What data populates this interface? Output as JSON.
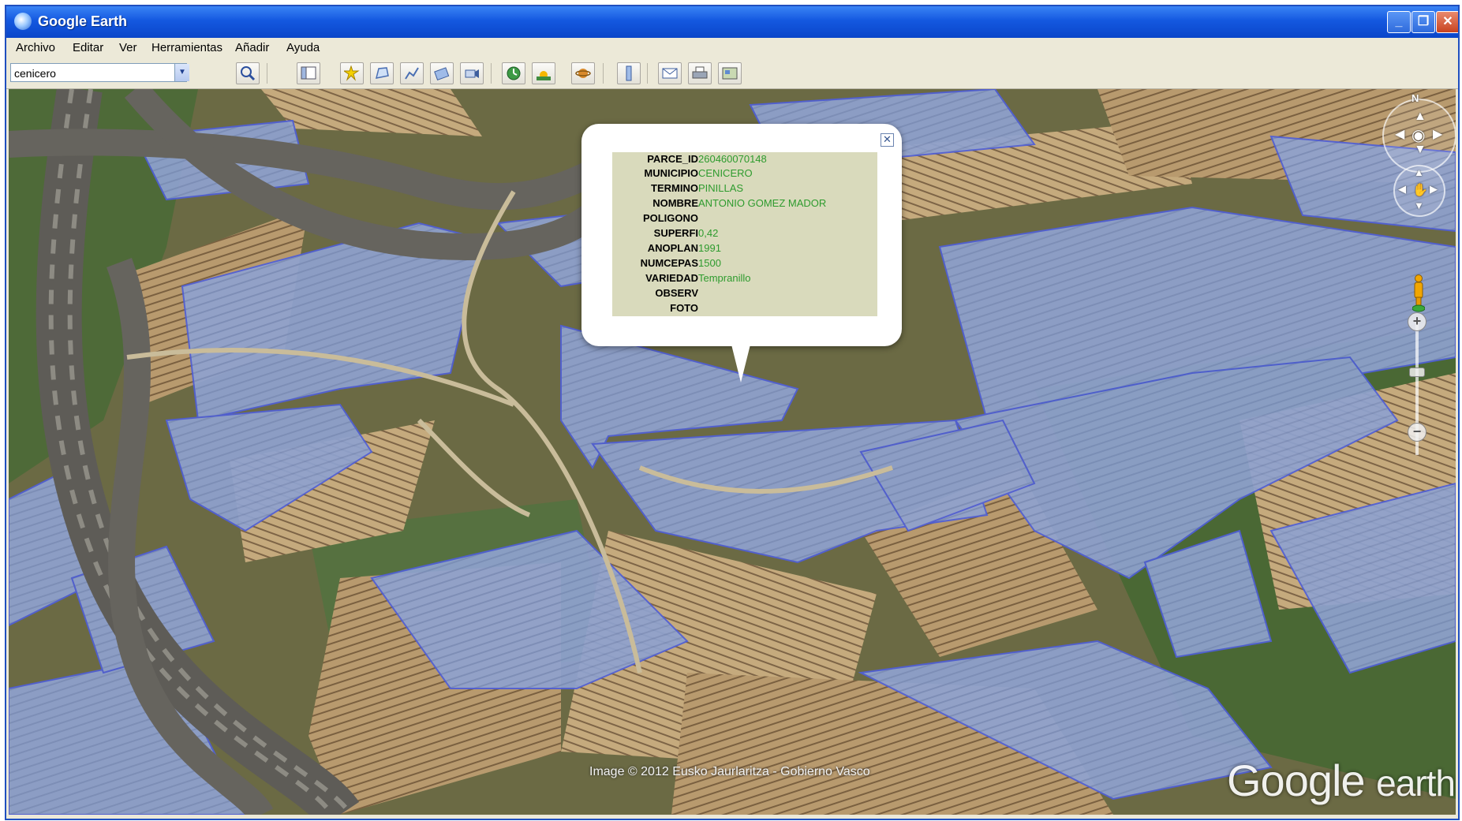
{
  "window": {
    "title": "Google Earth",
    "controls": {
      "minimize": "_",
      "restore": "❐",
      "close": "✕"
    }
  },
  "menu": {
    "items": [
      "Archivo",
      "Editar",
      "Ver",
      "Herramientas",
      "Añadir",
      "Ayuda"
    ]
  },
  "search": {
    "value": "cenicero",
    "dropdown_glyph": "▼"
  },
  "toolbar": {
    "icons": [
      "search-icon",
      "sidebar-toggle-icon",
      "add-placemark-icon",
      "add-polygon-icon",
      "add-path-icon",
      "add-overlay-icon",
      "record-tour-icon",
      "historical-imagery-icon",
      "sunlight-icon",
      "switch-to-sky-icon",
      "ruler-icon",
      "email-icon",
      "print-icon",
      "view-in-maps-icon"
    ]
  },
  "popup": {
    "close_glyph": "✕",
    "rows": [
      {
        "key": "PARCE_ID",
        "value": "260460070148"
      },
      {
        "key": "MUNICIPIO",
        "value": "CENICERO"
      },
      {
        "key": "TERMINO",
        "value": "PINILLAS"
      },
      {
        "key": "NOMBRE",
        "value": "ANTONIO GOMEZ MADOR"
      },
      {
        "key": "POLIGONO",
        "value": ""
      },
      {
        "key": "SUPERFI",
        "value": "0,42"
      },
      {
        "key": "ANOPLAN",
        "value": "1991"
      },
      {
        "key": "NUMCEPAS",
        "value": "1500"
      },
      {
        "key": "VARIEDAD",
        "value": "Tempranillo"
      },
      {
        "key": "OBSERV",
        "value": ""
      },
      {
        "key": "FOTO",
        "value": ""
      }
    ]
  },
  "navigation": {
    "north_label": "N",
    "zoom_in": "+",
    "zoom_out": "−"
  },
  "map": {
    "copyright": "Image © 2012 Eusko Jaurlaritza - Gobierno Vasco",
    "logo_google": "Google",
    "logo_earth": "earth"
  },
  "colors": {
    "title_bar": "#1458e0",
    "parcel_overlay": "#8fa6d9",
    "value_text": "#2e9b2e"
  }
}
